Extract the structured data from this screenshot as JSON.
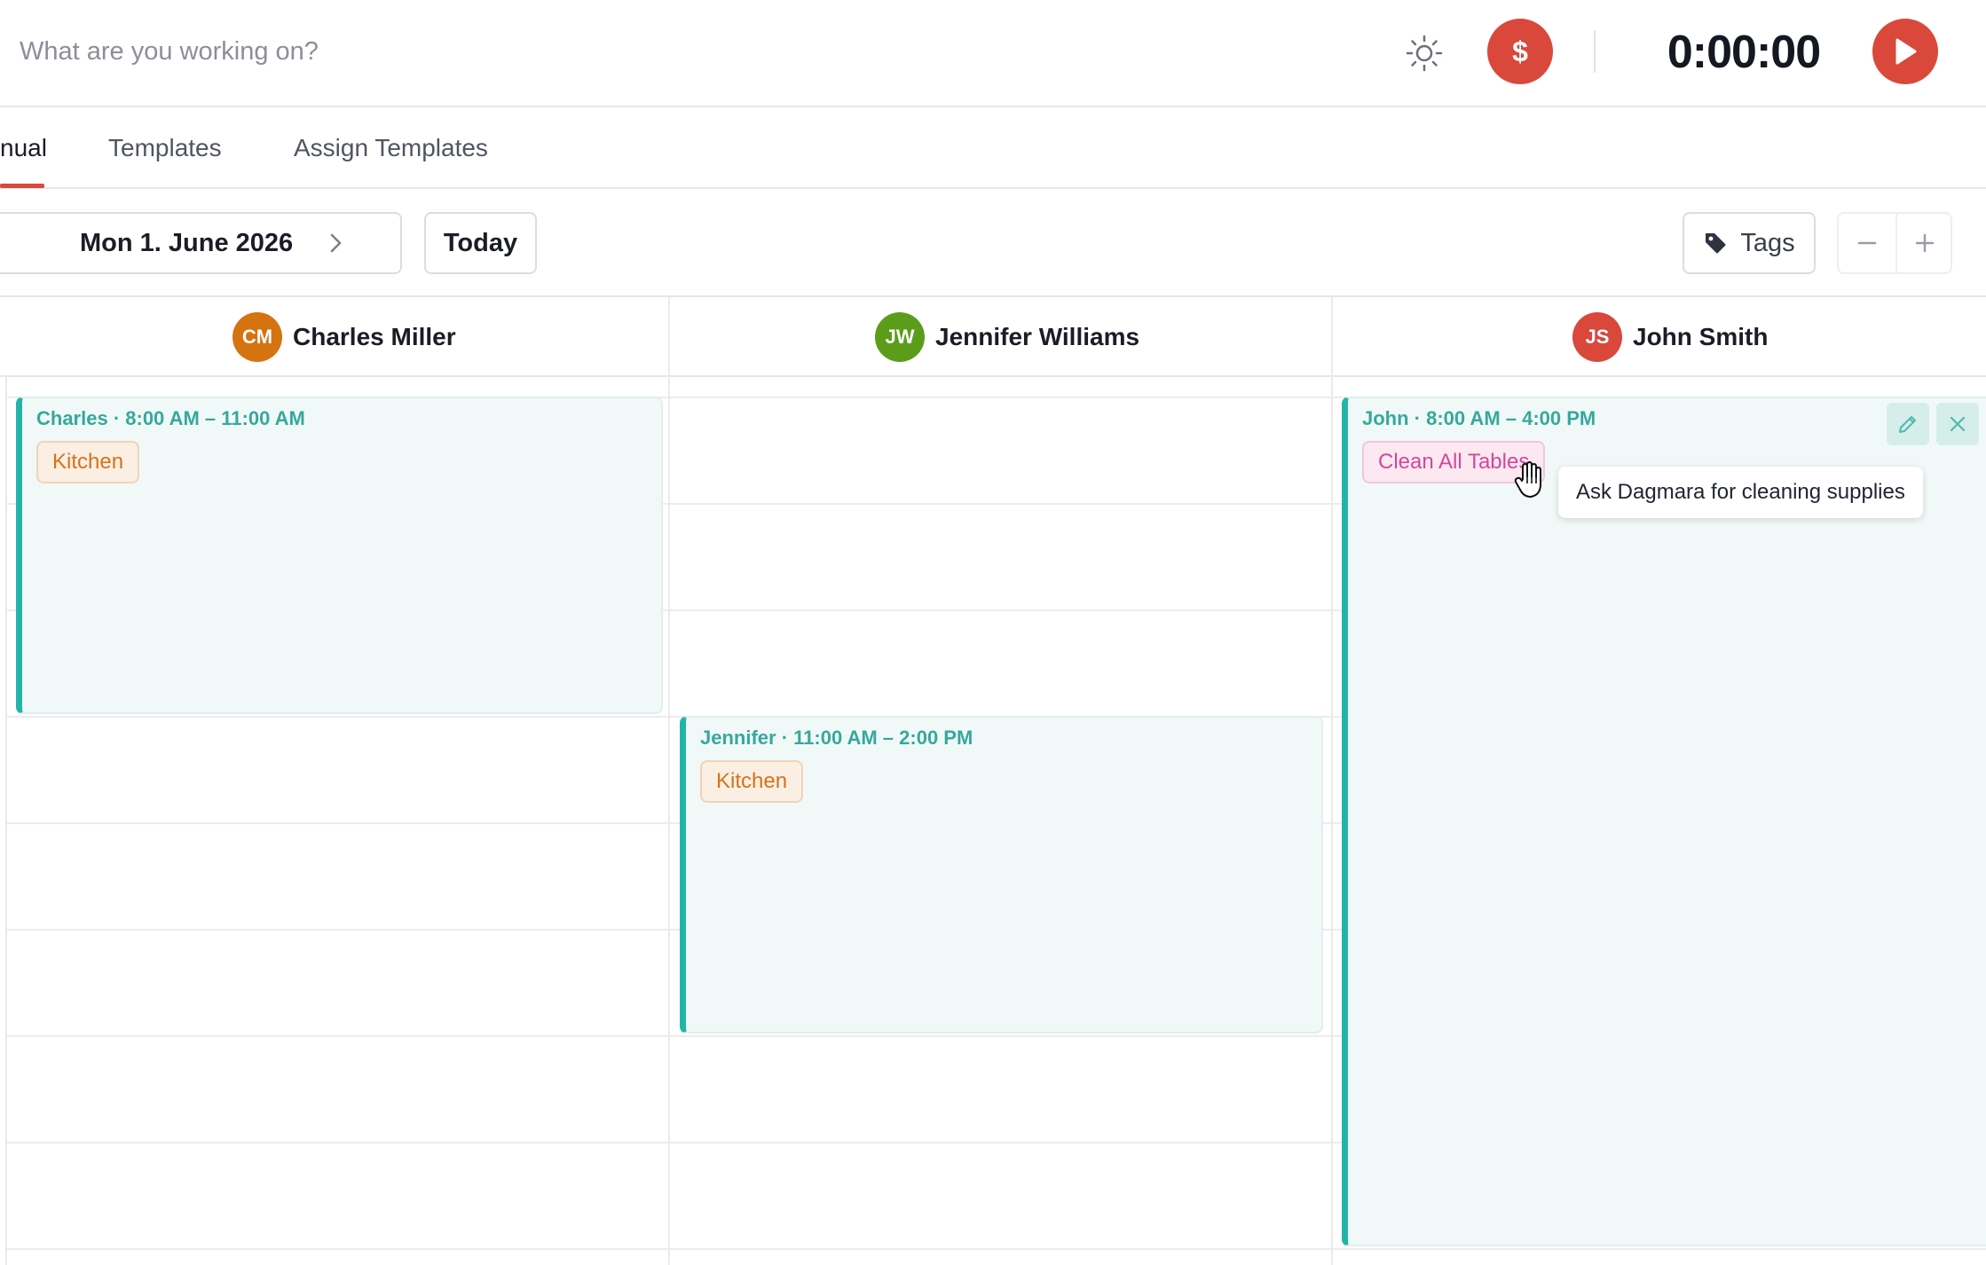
{
  "topbar": {
    "placeholder": "What are you working on?",
    "billing_symbol": "$",
    "timer": "0:00:00",
    "theme_icon": "sun-icon",
    "play_icon": "play-icon"
  },
  "tabs": [
    {
      "label": "nual",
      "active": true
    },
    {
      "label": "Templates",
      "active": false
    },
    {
      "label": "Assign Templates",
      "active": false
    }
  ],
  "toolbar": {
    "date": "Mon 1. June 2026",
    "today": "Today",
    "tags": "Tags"
  },
  "employees": [
    {
      "initials": "CM",
      "name": "Charles Miller",
      "color": "#d4730f"
    },
    {
      "initials": "JW",
      "name": "Jennifer Williams",
      "color": "#5b9d1a"
    },
    {
      "initials": "JS",
      "name": "John Smith",
      "color": "#d9483b"
    }
  ],
  "shifts": [
    {
      "title": "Charles · 8:00 AM – 11:00 AM",
      "tag": "Kitchen"
    },
    {
      "title": "Jennifer · 11:00 AM – 2:00 PM",
      "tag": "Kitchen"
    },
    {
      "title": "John · 8:00 AM – 4:00 PM",
      "tag": "Clean All Tables"
    }
  ],
  "tooltip": "Ask Dagmara for cleaning supplies",
  "colors": {
    "accent": "#d9483b",
    "shift_bar": "#22b5a7",
    "shift_bg": "#f1f9f8",
    "kitchen_text": "#d4731b",
    "clean_text": "#d4479a"
  }
}
